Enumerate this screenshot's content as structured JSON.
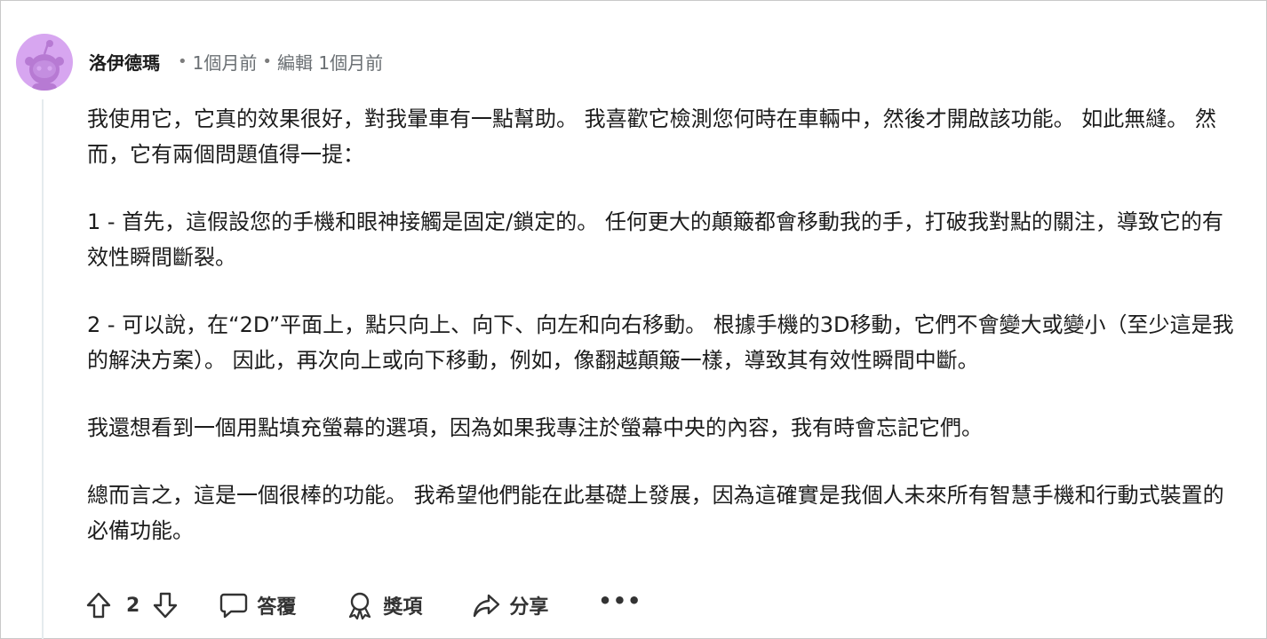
{
  "comment": {
    "author": "洛伊德瑪",
    "separator": "•",
    "time": "1個月前",
    "edited": "編輯 1個月前",
    "paragraphs": [
      "我使用它，它真的效果很好，對我暈車有一點幫助。 我喜歡它檢測您何時在車輛中，然後才開啟該功能。 如此無縫。 然而，它有兩個問題值得一提：",
      "1 - 首先，這假設您的手機和眼神接觸是固定/鎖定的。 任何更大的顛簸都會移動我的手，打破我對點的關注，導致它的有效性瞬間斷裂。",
      "2 - 可以說，在“2D”平面上，點只向上、向下、向左和向右移動。 根據手機的3D移動，它們不會變大或變小（至少這是我的解決方案）。 因此，再次向上或向下移動，例如，像翻越顛簸一樣，導致其有效性瞬間中斷。",
      "我還想看到一個用點填充螢幕的選項，因為如果我專注於螢幕中央的內容，我有時會忘記它們。",
      "總而言之，這是一個很棒的功能。 我希望他們能在此基礎上發展，因為這確實是我個人未來所有智慧手機和行動式裝置的必備功能。"
    ]
  },
  "actions": {
    "upvote_icon": "arrow-up-outline",
    "vote_count": "2",
    "downvote_icon": "arrow-down-outline",
    "reply_label": "答覆",
    "reply_icon": "speech-bubble",
    "award_label": "獎項",
    "award_icon": "award-ribbon",
    "share_label": "分享",
    "share_icon": "share-arrow",
    "more_label": "•••"
  },
  "colors": {
    "avatar_bg": "#d7a6f0",
    "text": "#1c1c1c",
    "muted": "#6a6f73",
    "thread_line": "#e5ebee"
  }
}
